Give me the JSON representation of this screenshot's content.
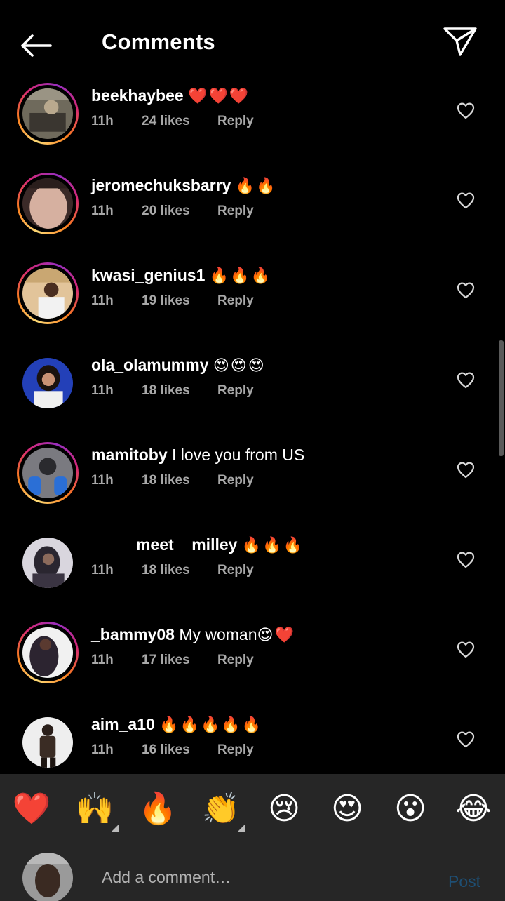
{
  "header": {
    "title": "Comments"
  },
  "comments": [
    {
      "user": "beekhaybee",
      "text": "",
      "emoji": "❤️❤️❤️",
      "time": "11h",
      "likes": "24 likes",
      "reply": "Reply",
      "story_ring": true
    },
    {
      "user": "jeromechuksbarry",
      "text": "",
      "emoji": "🔥🔥",
      "time": "11h",
      "likes": "20 likes",
      "reply": "Reply",
      "story_ring": true
    },
    {
      "user": "kwasi_genius1",
      "text": "",
      "emoji": "🔥🔥🔥",
      "time": "11h",
      "likes": "19 likes",
      "reply": "Reply",
      "story_ring": true
    },
    {
      "user": "ola_olamummy",
      "text": "",
      "emoji": "😍😍😍",
      "time": "11h",
      "likes": "18 likes",
      "reply": "Reply",
      "story_ring": false
    },
    {
      "user": "mamitoby",
      "text": "I love you from US",
      "emoji": "",
      "time": "11h",
      "likes": "18 likes",
      "reply": "Reply",
      "story_ring": true
    },
    {
      "user": "_____meet__milley",
      "text": "",
      "emoji": "🔥🔥🔥",
      "time": "11h",
      "likes": "18 likes",
      "reply": "Reply",
      "story_ring": false
    },
    {
      "user": "_bammy08",
      "text": "My woman",
      "emoji": "😍❤️",
      "time": "11h",
      "likes": "17 likes",
      "reply": "Reply",
      "story_ring": true
    },
    {
      "user": "aim_a10",
      "text": "",
      "emoji": "🔥🔥🔥🔥🔥",
      "time": "11h",
      "likes": "16 likes",
      "reply": "Reply",
      "story_ring": false
    }
  ],
  "reactions": [
    {
      "emoji": "❤️",
      "name": "red-heart"
    },
    {
      "emoji": "🙌",
      "name": "raising-hands",
      "has_variants": true
    },
    {
      "emoji": "🔥",
      "name": "fire"
    },
    {
      "emoji": "👏",
      "name": "clapping-hands",
      "has_variants": true
    },
    {
      "emoji": "😢",
      "name": "crying-face"
    },
    {
      "emoji": "😍",
      "name": "heart-eyes"
    },
    {
      "emoji": "😮",
      "name": "open-mouth"
    },
    {
      "emoji": "😂",
      "name": "tears-of-joy"
    }
  ],
  "composer": {
    "placeholder": "Add a comment…",
    "post_label": "Post"
  },
  "colors": {
    "background": "#000000",
    "muted_text": "#a8a8a8",
    "bar_background": "#262626",
    "post_disabled": "#1e4f74"
  }
}
